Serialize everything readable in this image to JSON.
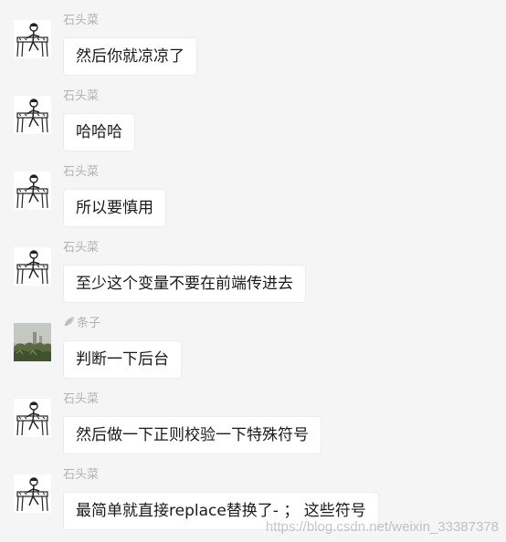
{
  "messages": [
    {
      "sender": "石头菜",
      "text": "然后你就凉凉了",
      "avatar": "sketch-avatar"
    },
    {
      "sender": "石头菜",
      "text": "哈哈哈",
      "avatar": "sketch-avatar"
    },
    {
      "sender": "石头菜",
      "text": "所以要慎用",
      "avatar": "sketch-avatar"
    },
    {
      "sender": "石头菜",
      "text": "至少这个变量不要在前端传进去",
      "avatar": "sketch-avatar"
    },
    {
      "sender": "条子",
      "text": "判断一下后台",
      "avatar": "photo-avatar",
      "sender_icon": "leaf-icon"
    },
    {
      "sender": "石头菜",
      "text": "然后做一下正则校验一下特殊符号",
      "avatar": "sketch-avatar"
    },
    {
      "sender": "石头菜",
      "text": "最简单就直接replace替换了- ； 这些符号",
      "avatar": "sketch-avatar"
    }
  ],
  "watermark": "https://blog.csdn.net/weixin_33387378",
  "colors": {
    "background": "#f5f5f5",
    "bubble": "#ffffff",
    "sender": "#b2b2b2",
    "text": "#1a1a1a"
  }
}
